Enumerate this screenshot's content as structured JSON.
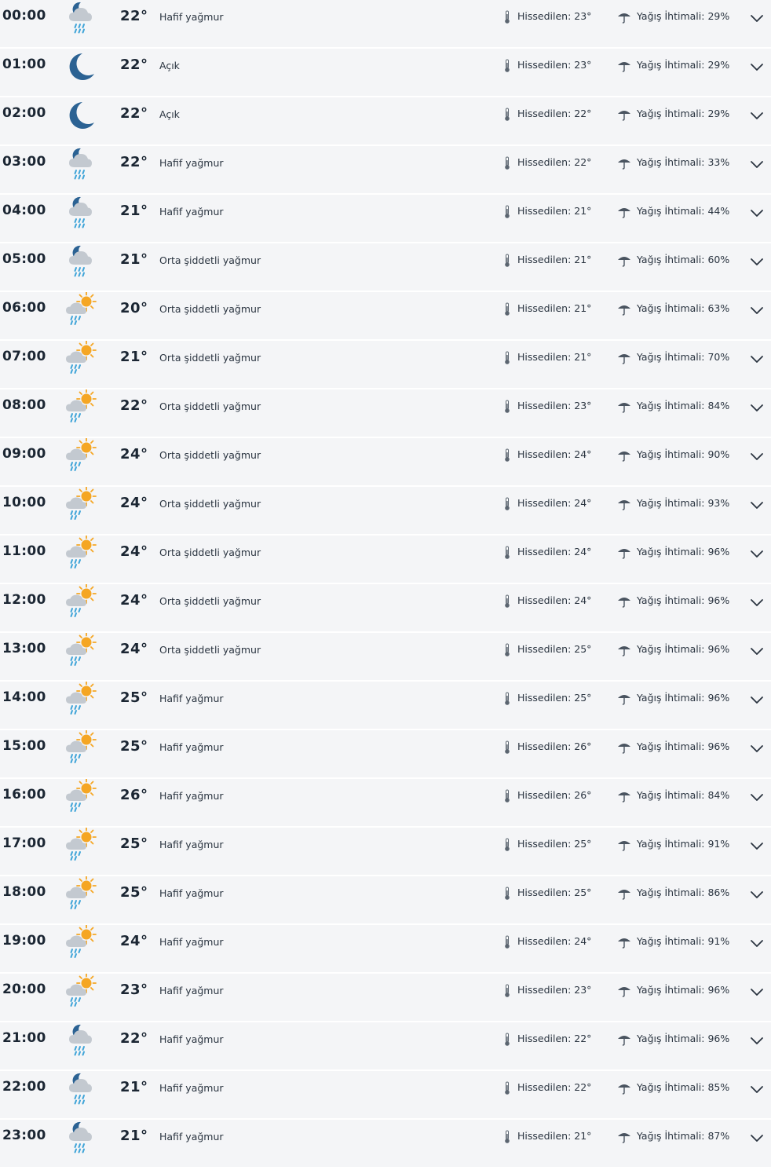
{
  "labels": {
    "feels_prefix": "Hissedilen:",
    "rain_prefix": "Yağış İhtimali:"
  },
  "colors": {
    "row_bg": "#f4f5f7",
    "moon": "#2b6293",
    "sun": "#f5a623",
    "cloud": "#c3c9d0",
    "rain_drop": "#3fa4d8"
  },
  "hours": [
    {
      "time": "00:00",
      "icon": "night-rain-icon",
      "temp": "22°",
      "condition": "Hafif yağmur",
      "feels": "23°",
      "rain_chance": "29%"
    },
    {
      "time": "01:00",
      "icon": "moon-icon",
      "temp": "22°",
      "condition": "Açık",
      "feels": "23°",
      "rain_chance": "29%"
    },
    {
      "time": "02:00",
      "icon": "moon-icon",
      "temp": "22°",
      "condition": "Açık",
      "feels": "22°",
      "rain_chance": "29%"
    },
    {
      "time": "03:00",
      "icon": "night-rain-icon",
      "temp": "22°",
      "condition": "Hafif yağmur",
      "feels": "22°",
      "rain_chance": "33%"
    },
    {
      "time": "04:00",
      "icon": "night-rain-icon",
      "temp": "21°",
      "condition": "Hafif yağmur",
      "feels": "21°",
      "rain_chance": "44%"
    },
    {
      "time": "05:00",
      "icon": "night-rain-icon",
      "temp": "21°",
      "condition": "Orta şiddetli yağmur",
      "feels": "21°",
      "rain_chance": "60%"
    },
    {
      "time": "06:00",
      "icon": "day-rain-icon",
      "temp": "20°",
      "condition": "Orta şiddetli yağmur",
      "feels": "21°",
      "rain_chance": "63%"
    },
    {
      "time": "07:00",
      "icon": "day-rain-icon",
      "temp": "21°",
      "condition": "Orta şiddetli yağmur",
      "feels": "21°",
      "rain_chance": "70%"
    },
    {
      "time": "08:00",
      "icon": "day-rain-icon",
      "temp": "22°",
      "condition": "Orta şiddetli yağmur",
      "feels": "23°",
      "rain_chance": "84%"
    },
    {
      "time": "09:00",
      "icon": "day-rain-icon",
      "temp": "24°",
      "condition": "Orta şiddetli yağmur",
      "feels": "24°",
      "rain_chance": "90%"
    },
    {
      "time": "10:00",
      "icon": "day-rain-icon",
      "temp": "24°",
      "condition": "Orta şiddetli yağmur",
      "feels": "24°",
      "rain_chance": "93%"
    },
    {
      "time": "11:00",
      "icon": "day-rain-icon",
      "temp": "24°",
      "condition": "Orta şiddetli yağmur",
      "feels": "24°",
      "rain_chance": "96%"
    },
    {
      "time": "12:00",
      "icon": "day-rain-icon",
      "temp": "24°",
      "condition": "Orta şiddetli yağmur",
      "feels": "24°",
      "rain_chance": "96%"
    },
    {
      "time": "13:00",
      "icon": "day-rain-icon",
      "temp": "24°",
      "condition": "Orta şiddetli yağmur",
      "feels": "25°",
      "rain_chance": "96%"
    },
    {
      "time": "14:00",
      "icon": "day-rain-icon",
      "temp": "25°",
      "condition": "Hafif yağmur",
      "feels": "25°",
      "rain_chance": "96%"
    },
    {
      "time": "15:00",
      "icon": "day-rain-icon",
      "temp": "25°",
      "condition": "Hafif yağmur",
      "feels": "26°",
      "rain_chance": "96%"
    },
    {
      "time": "16:00",
      "icon": "day-rain-icon",
      "temp": "26°",
      "condition": "Hafif yağmur",
      "feels": "26°",
      "rain_chance": "84%"
    },
    {
      "time": "17:00",
      "icon": "day-rain-icon",
      "temp": "25°",
      "condition": "Hafif yağmur",
      "feels": "25°",
      "rain_chance": "91%"
    },
    {
      "time": "18:00",
      "icon": "day-rain-icon",
      "temp": "25°",
      "condition": "Hafif yağmur",
      "feels": "25°",
      "rain_chance": "86%"
    },
    {
      "time": "19:00",
      "icon": "day-rain-icon",
      "temp": "24°",
      "condition": "Hafif yağmur",
      "feels": "24°",
      "rain_chance": "91%"
    },
    {
      "time": "20:00",
      "icon": "day-rain-icon",
      "temp": "23°",
      "condition": "Hafif yağmur",
      "feels": "23°",
      "rain_chance": "96%"
    },
    {
      "time": "21:00",
      "icon": "night-rain-icon",
      "temp": "22°",
      "condition": "Hafif yağmur",
      "feels": "22°",
      "rain_chance": "96%"
    },
    {
      "time": "22:00",
      "icon": "night-rain-icon",
      "temp": "21°",
      "condition": "Hafif yağmur",
      "feels": "22°",
      "rain_chance": "85%"
    },
    {
      "time": "23:00",
      "icon": "night-rain-icon",
      "temp": "21°",
      "condition": "Hafif yağmur",
      "feels": "21°",
      "rain_chance": "87%"
    }
  ]
}
